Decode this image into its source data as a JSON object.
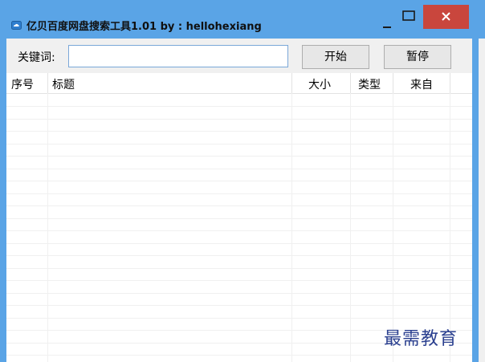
{
  "window": {
    "title": "亿贝百度网盘搜索工具1.01 by : hellohexiang"
  },
  "search": {
    "label": "关键词:",
    "value": "",
    "placeholder": ""
  },
  "buttons": {
    "start": "开始",
    "pause": "暂停"
  },
  "table": {
    "columns": [
      "序号",
      "标题",
      "大小",
      "类型",
      "来自"
    ],
    "rows": []
  },
  "watermark": "最需教育",
  "colors": {
    "titlebar": "#5aa4e6",
    "close": "#c9463d"
  }
}
